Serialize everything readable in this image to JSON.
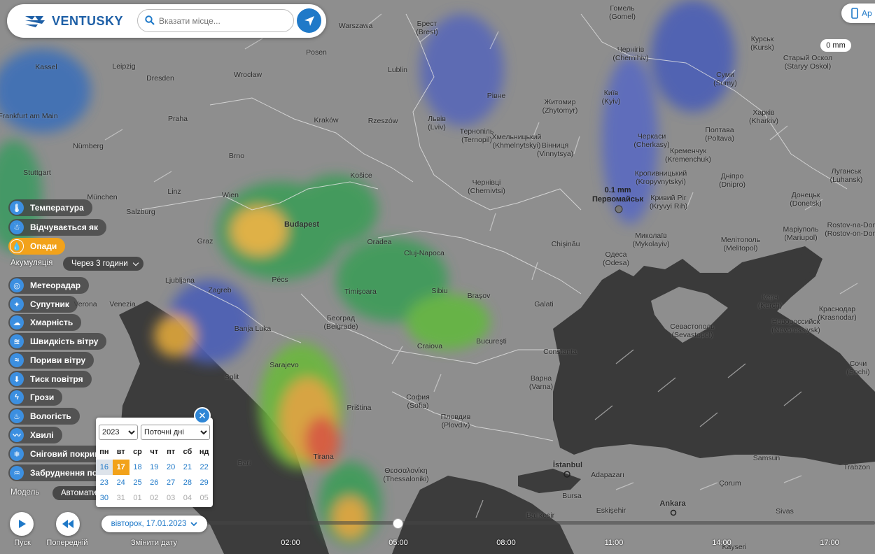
{
  "header": {
    "logo_text": "VENTUSKY",
    "search_placeholder": "Вказати місце...",
    "app_button_label": "Ap",
    "precip_badge": "0 mm"
  },
  "pin": {
    "value": "0.1 mm",
    "city": "Первомайськ"
  },
  "cities": [
    {
      "name": "Gomel'",
      "line1": "Гомель",
      "line2": "(Gomel)"
    },
    {
      "name": "Warszawa"
    },
    {
      "name": "Брест",
      "line2": "(Brest)"
    },
    {
      "name": "Курськ",
      "line2": "(Kursk)"
    },
    {
      "name": "Старый Оскол",
      "line2": "(Staryy Oskol)"
    },
    {
      "name": "Чернігів",
      "line2": "(Chernihiv)"
    },
    {
      "name": "Суми",
      "line2": "(Sumy)"
    },
    {
      "name": "Kassel"
    },
    {
      "name": "Leipzig"
    },
    {
      "name": "Posen"
    },
    {
      "name": "Dresden"
    },
    {
      "name": "Wrocław"
    },
    {
      "name": "Lublin"
    },
    {
      "name": "Київ",
      "line2": "(Kyiv)"
    },
    {
      "name": "Рівне"
    },
    {
      "name": "Житомир",
      "line2": "(Zhytomyr)"
    },
    {
      "name": "Харків",
      "line2": "(Kharkiv)"
    },
    {
      "name": "Frankfurt am Main"
    },
    {
      "name": "Praha"
    },
    {
      "name": "Kraków"
    },
    {
      "name": "Rzeszów"
    },
    {
      "name": "Львів",
      "line2": "(Lviv)"
    },
    {
      "name": "Тернопіль",
      "line2": "(Ternopil)"
    },
    {
      "name": "Хмельницький",
      "line2": "(Khmelnytskyi)"
    },
    {
      "name": "Вінниця",
      "line2": "(Vinnytsya)"
    },
    {
      "name": "Черкаси",
      "line2": "(Cherkasy)"
    },
    {
      "name": "Кременчук",
      "line2": "(Kremenchuk)"
    },
    {
      "name": "Полтава",
      "line2": "(Poltava)"
    },
    {
      "name": "Nürnberg"
    },
    {
      "name": "Brno"
    },
    {
      "name": "Дніпро",
      "line2": "(Dnipro)"
    },
    {
      "name": "Кропивницький",
      "line2": "(Kropyvnytskyi)"
    },
    {
      "name": "Кривий Ріг",
      "line2": "(Kryvyi Rih)"
    },
    {
      "name": "Луганськ",
      "line2": "(Luhansk)"
    },
    {
      "name": "Донецьк",
      "line2": "(Donetsk)"
    },
    {
      "name": "Stuttgart"
    },
    {
      "name": "Košice"
    },
    {
      "name": "Чернівці",
      "line2": "(Chernivtsi)"
    },
    {
      "name": "Linz"
    },
    {
      "name": "Wien"
    },
    {
      "name": "München"
    },
    {
      "name": "Salzburg"
    },
    {
      "name": "Budapest"
    },
    {
      "name": "Oradea"
    },
    {
      "name": "Cluj-Napoca"
    },
    {
      "name": "Chişinău"
    },
    {
      "name": "Миколаїв",
      "line2": "(Mykolayiv)"
    },
    {
      "name": "Мелітополь",
      "line2": "(Melitopol)"
    },
    {
      "name": "Маріуполь",
      "line2": "(Mariupol)"
    },
    {
      "name": "Rostov-na-Don",
      "line2": "(Rostov-on-Don)"
    },
    {
      "name": "Graz"
    },
    {
      "name": "Одеса",
      "line2": "(Odesa)"
    },
    {
      "name": "Ljubljana"
    },
    {
      "name": "Pécs"
    },
    {
      "name": "Zagreb"
    },
    {
      "name": "Timişoara"
    },
    {
      "name": "Sibiu"
    },
    {
      "name": "Braşov"
    },
    {
      "name": "Керч",
      "line2": "(Kerch)"
    },
    {
      "name": "Verona"
    },
    {
      "name": "Venezia"
    },
    {
      "name": "Galati"
    },
    {
      "name": "Краснодар",
      "line2": "(Krasnodar)"
    },
    {
      "name": "Београд",
      "line2": "(Belgrade)"
    },
    {
      "name": "Banja Luka"
    },
    {
      "name": "Новороссийск",
      "line2": "(Novorossiysk)"
    },
    {
      "name": "Севастополь",
      "line2": "(Sevastopol)"
    },
    {
      "name": "Bucureşti"
    },
    {
      "name": "Craiova"
    },
    {
      "name": "Constanta"
    },
    {
      "name": "Sarajevo"
    },
    {
      "name": "Split"
    },
    {
      "name": "Сочи",
      "line2": "(Sochi)"
    },
    {
      "name": "Варна",
      "line2": "(Varna)"
    },
    {
      "name": "София",
      "line2": "(Sofia)"
    },
    {
      "name": "Priština"
    },
    {
      "name": "Пловдив",
      "line2": "(Plovdiv)"
    },
    {
      "name": "Bari"
    },
    {
      "name": "Tirana"
    },
    {
      "name": "İstanbul"
    },
    {
      "name": "Samsun"
    },
    {
      "name": "Trabzon"
    },
    {
      "name": "Adapazarı"
    },
    {
      "name": "Θεσσαλονίκη",
      "line2": "(Thessaloniki)"
    },
    {
      "name": "Çorum"
    },
    {
      "name": "Bursa"
    },
    {
      "name": "Ankara"
    },
    {
      "name": "Balıkesir"
    },
    {
      "name": "Eskişehir"
    },
    {
      "name": "Sivas"
    },
    {
      "name": "Kayseri"
    }
  ],
  "layers": [
    {
      "label": "Температура",
      "icon": "thermometer-icon"
    },
    {
      "label": "Відчувається як",
      "icon": "feels-like-icon"
    },
    {
      "label": "Опади",
      "icon": "drop-icon",
      "active": true
    },
    {
      "label": "Метеорадар",
      "icon": "radar-icon"
    },
    {
      "label": "Супутник",
      "icon": "satellite-icon"
    },
    {
      "label": "Хмарність",
      "icon": "cloud-icon"
    },
    {
      "label": "Швидкість вітру",
      "icon": "wind-icon"
    },
    {
      "label": "Пориви вітру",
      "icon": "gust-icon"
    },
    {
      "label": "Тиск повітря",
      "icon": "pressure-icon"
    },
    {
      "label": "Грози",
      "icon": "lightning-icon"
    },
    {
      "label": "Вологість",
      "icon": "humidity-icon"
    },
    {
      "label": "Хвилі",
      "icon": "waves-icon"
    },
    {
      "label": "Сніговий покрив",
      "icon": "snowflake-icon"
    },
    {
      "label": "Забруднення пов",
      "icon": "pollution-icon"
    }
  ],
  "accumulation": {
    "label": "Акумуляція",
    "value": "Через 3 години"
  },
  "model": {
    "label": "Модель",
    "value": "Автоматич"
  },
  "calendar": {
    "year": "2023",
    "mode": "Поточні дні",
    "weekdays": [
      "пн",
      "вт",
      "ср",
      "чт",
      "пт",
      "сб",
      "нд"
    ],
    "weeks": [
      [
        "16",
        "17",
        "18",
        "19",
        "20",
        "21",
        "22"
      ],
      [
        "23",
        "24",
        "25",
        "26",
        "27",
        "28",
        "29"
      ],
      [
        "30",
        "31",
        "01",
        "02",
        "03",
        "04",
        "05"
      ]
    ],
    "selected": "17"
  },
  "timeline": {
    "date_label": "вівторок, 17.01.2023",
    "play_label": "Пуск",
    "prev_label": "Попередній",
    "change_date_label": "Змінити дату",
    "ticks": [
      "02:00",
      "05:00",
      "08:00",
      "11:00",
      "14:00",
      "17:00"
    ]
  },
  "colors": {
    "accent": "#1f79c8",
    "active": "#f2a21a"
  }
}
